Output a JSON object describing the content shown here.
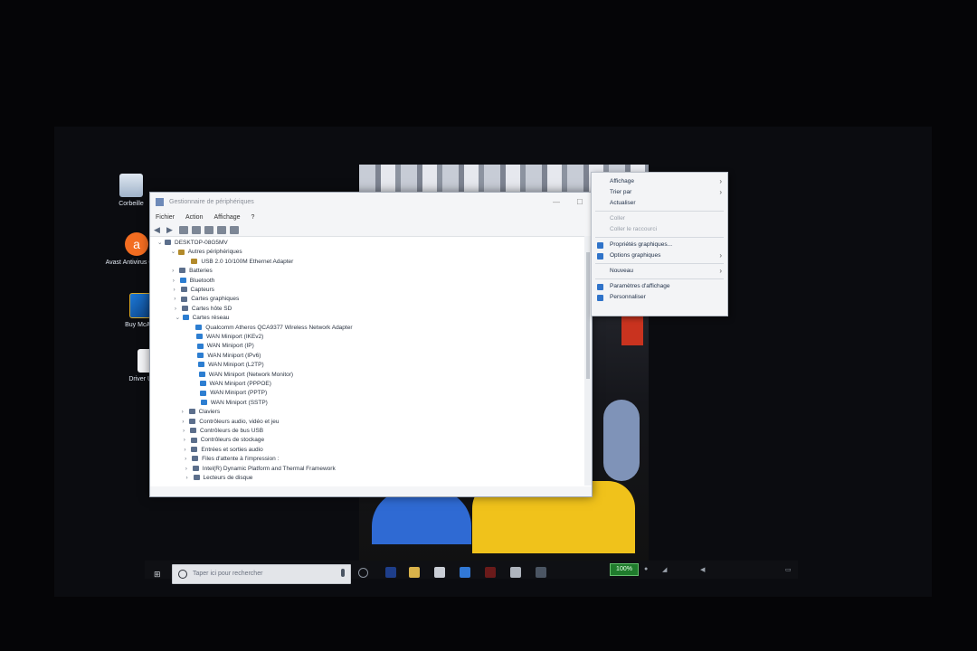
{
  "desktop": {
    "icons": [
      {
        "label": "Corbeille",
        "icon": "recycle-bin-icon"
      },
      {
        "label": "Avast Antivirus Gratuit",
        "icon": "avast-icon"
      },
      {
        "label": "Buy McAfee",
        "icon": "mcafee-icon"
      },
      {
        "label": "Driver Updat",
        "icon": "document-icon"
      }
    ]
  },
  "device_manager": {
    "title": "Gestionnaire de périphériques",
    "menu": [
      "Fichier",
      "Action",
      "Affichage",
      "?"
    ],
    "tree": [
      {
        "label": "DESKTOP-08G5MV",
        "depth": 0,
        "toggle": "⌄",
        "icon": "computer"
      },
      {
        "label": "Autres périphériques",
        "depth": 1,
        "toggle": "⌄",
        "icon": "warn"
      },
      {
        "label": "USB 2.0 10/100M Ethernet Adapter",
        "depth": 2,
        "toggle": "",
        "icon": "warn"
      },
      {
        "label": "Batteries",
        "depth": 1,
        "toggle": "›",
        "icon": "generic"
      },
      {
        "label": "Bluetooth",
        "depth": 1,
        "toggle": "›",
        "icon": "net"
      },
      {
        "label": "Capteurs",
        "depth": 1,
        "toggle": "›",
        "icon": "generic"
      },
      {
        "label": "Cartes graphiques",
        "depth": 1,
        "toggle": "›",
        "icon": "generic"
      },
      {
        "label": "Cartes hôte SD",
        "depth": 1,
        "toggle": "›",
        "icon": "generic"
      },
      {
        "label": "Cartes réseau",
        "depth": 1,
        "toggle": "⌄",
        "icon": "net"
      },
      {
        "label": "Qualcomm Atheros QCA9377 Wireless Network Adapter",
        "depth": 2,
        "toggle": "",
        "icon": "net"
      },
      {
        "label": "WAN Miniport (IKEv2)",
        "depth": 2,
        "toggle": "",
        "icon": "net"
      },
      {
        "label": "WAN Miniport (IP)",
        "depth": 2,
        "toggle": "",
        "icon": "net"
      },
      {
        "label": "WAN Miniport (IPv6)",
        "depth": 2,
        "toggle": "",
        "icon": "net"
      },
      {
        "label": "WAN Miniport (L2TP)",
        "depth": 2,
        "toggle": "",
        "icon": "net"
      },
      {
        "label": "WAN Miniport (Network Monitor)",
        "depth": 2,
        "toggle": "",
        "icon": "net"
      },
      {
        "label": "WAN Miniport (PPPOE)",
        "depth": 2,
        "toggle": "",
        "icon": "net"
      },
      {
        "label": "WAN Miniport (PPTP)",
        "depth": 2,
        "toggle": "",
        "icon": "net"
      },
      {
        "label": "WAN Miniport (SSTP)",
        "depth": 2,
        "toggle": "",
        "icon": "net"
      },
      {
        "label": "Claviers",
        "depth": 1,
        "toggle": "›",
        "icon": "generic"
      },
      {
        "label": "Contrôleurs audio, vidéo et jeu",
        "depth": 1,
        "toggle": "›",
        "icon": "generic"
      },
      {
        "label": "Contrôleurs de bus USB",
        "depth": 1,
        "toggle": "›",
        "icon": "generic"
      },
      {
        "label": "Contrôleurs de stockage",
        "depth": 1,
        "toggle": "›",
        "icon": "generic"
      },
      {
        "label": "Entrées et sorties audio",
        "depth": 1,
        "toggle": "›",
        "icon": "generic"
      },
      {
        "label": "Files d'attente à l'impression :",
        "depth": 1,
        "toggle": "›",
        "icon": "generic"
      },
      {
        "label": "Intel(R) Dynamic Platform and Thermal Framework",
        "depth": 1,
        "toggle": "›",
        "icon": "generic"
      },
      {
        "label": "Lecteurs de disque",
        "depth": 1,
        "toggle": "›",
        "icon": "generic"
      }
    ]
  },
  "context_menu": {
    "items": [
      {
        "label": "Affichage",
        "submenu": true,
        "disabled": false,
        "icon": ""
      },
      {
        "label": "Trier par",
        "submenu": true,
        "disabled": false,
        "icon": ""
      },
      {
        "label": "Actualiser",
        "submenu": false,
        "disabled": false,
        "icon": ""
      },
      {
        "sep": true
      },
      {
        "label": "Coller",
        "submenu": false,
        "disabled": true,
        "icon": ""
      },
      {
        "label": "Coller le raccourci",
        "submenu": false,
        "disabled": true,
        "icon": ""
      },
      {
        "sep": true
      },
      {
        "label": "Propriétés graphiques...",
        "submenu": false,
        "disabled": false,
        "icon": "graphics-icon"
      },
      {
        "label": "Options graphiques",
        "submenu": true,
        "disabled": false,
        "icon": "graphics-icon"
      },
      {
        "sep": true
      },
      {
        "label": "Nouveau",
        "submenu": true,
        "disabled": false,
        "icon": ""
      },
      {
        "sep": true
      },
      {
        "label": "Paramètres d'affichage",
        "submenu": false,
        "disabled": false,
        "icon": "display-icon"
      },
      {
        "label": "Personnaliser",
        "submenu": false,
        "disabled": false,
        "icon": "personalize-icon"
      }
    ]
  },
  "taskbar": {
    "search_placeholder": "Taper ici pour rechercher",
    "battery": "100%"
  },
  "colors": {
    "accent": "#2d7ed1",
    "battery_green": "#1f7b2c"
  }
}
